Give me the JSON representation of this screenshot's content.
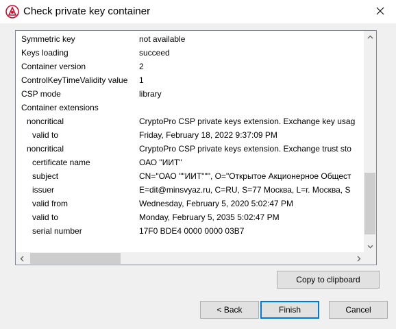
{
  "window": {
    "title": "Check private key container",
    "icon": "cryptopro-logo-icon",
    "close_icon": "close-icon"
  },
  "details": {
    "rows": [
      {
        "key": "Symmetric key",
        "value": "not available",
        "indent": 0
      },
      {
        "key": "Keys loading",
        "value": "succeed",
        "indent": 0
      },
      {
        "key": "Container version",
        "value": "2",
        "indent": 0
      },
      {
        "key": "ControlKeyTimeValidity value",
        "value": "1",
        "indent": 0
      },
      {
        "key": "CSP mode",
        "value": "library",
        "indent": 0
      },
      {
        "key": "Container extensions",
        "value": "",
        "indent": 0
      },
      {
        "key": "noncritical",
        "value": "CryptoPro CSP private keys extension. Exchange key usag",
        "indent": 1
      },
      {
        "key": "valid to",
        "value": "Friday, February 18, 2022 9:37:09 PM",
        "indent": 2
      },
      {
        "key": "noncritical",
        "value": "CryptoPro CSP private keys extension. Exchange trust sto",
        "indent": 1
      },
      {
        "key": "certificate name",
        "value": "ОАО \"ИИТ\"",
        "indent": 2
      },
      {
        "key": "subject",
        "value": "CN=\"ОАО \"\"ИИТ\"\"\", O=\"Открытое Акционерное Общест",
        "indent": 2
      },
      {
        "key": "issuer",
        "value": "E=dit@minsvyaz.ru, C=RU, S=77 Москва, L=г. Москва, S",
        "indent": 2
      },
      {
        "key": "valid from",
        "value": "Wednesday, February 5, 2020 5:02:47 PM",
        "indent": 2
      },
      {
        "key": "valid to",
        "value": "Monday, February 5, 2035 5:02:47 PM",
        "indent": 2
      },
      {
        "key": "serial number",
        "value": "17F0 BDE4 0000 0000 03B7",
        "indent": 2
      }
    ],
    "vertical_scroll_fraction": 1.0,
    "horizontal_scroll_fraction": 0.0
  },
  "buttons": {
    "copy": "Copy to clipboard",
    "back": "< Back",
    "finish": "Finish",
    "cancel": "Cancel"
  },
  "colors": {
    "accent": "#0078d7",
    "logo_red": "#c8102e"
  }
}
